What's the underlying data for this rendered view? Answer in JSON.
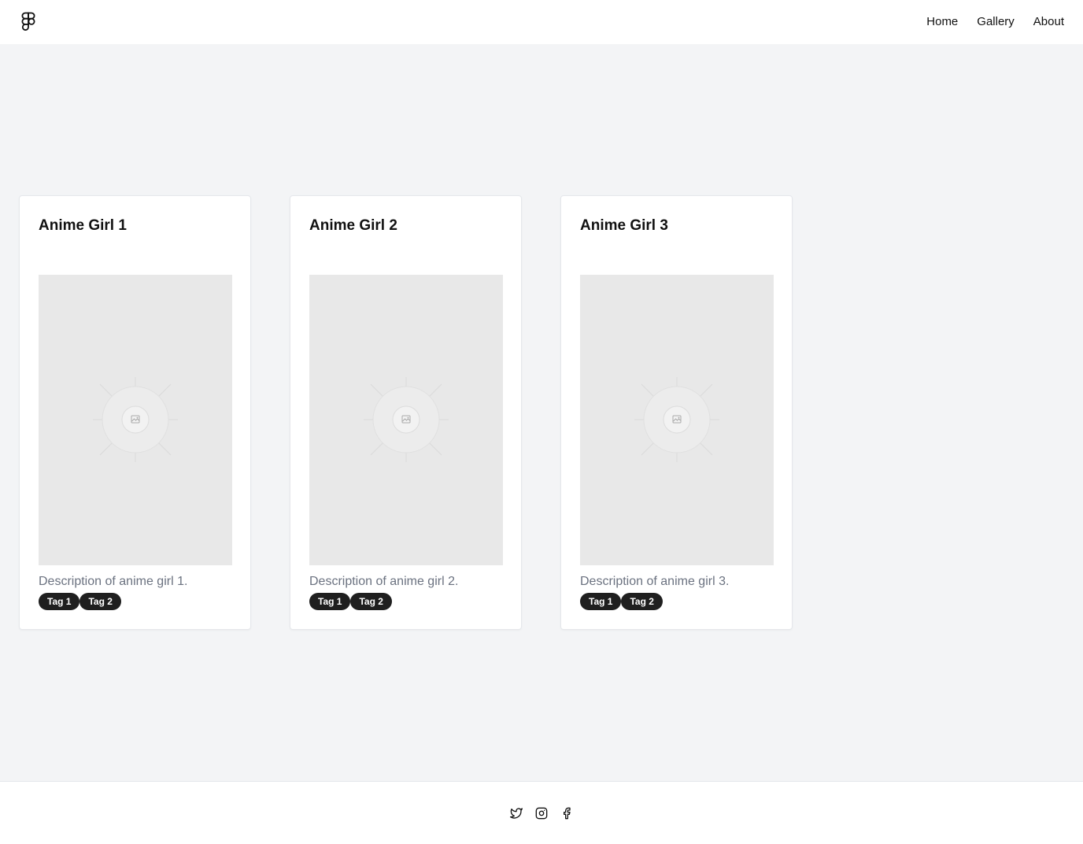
{
  "header": {
    "logo_icon": "figma-logo-icon",
    "nav": [
      {
        "label": "Home"
      },
      {
        "label": "Gallery"
      },
      {
        "label": "About"
      }
    ]
  },
  "cards": [
    {
      "title": "Anime Girl 1",
      "image_icon": "image-placeholder-icon",
      "description": "Description of anime girl 1.",
      "tags": [
        "Tag 1",
        "Tag 2"
      ]
    },
    {
      "title": "Anime Girl 2",
      "image_icon": "image-placeholder-icon",
      "description": "Description of anime girl 2.",
      "tags": [
        "Tag 1",
        "Tag 2"
      ]
    },
    {
      "title": "Anime Girl 3",
      "image_icon": "image-placeholder-icon",
      "description": "Description of anime girl 3.",
      "tags": [
        "Tag 1",
        "Tag 2"
      ]
    }
  ],
  "footer": {
    "social_icons": [
      "twitter-icon",
      "instagram-icon",
      "facebook-icon"
    ]
  },
  "colors": {
    "page_background": "#f3f4f6",
    "card_background": "#ffffff",
    "tag_background": "#1f1f1f",
    "description_text": "#6b7280",
    "image_placeholder": "#e8e8e8"
  }
}
